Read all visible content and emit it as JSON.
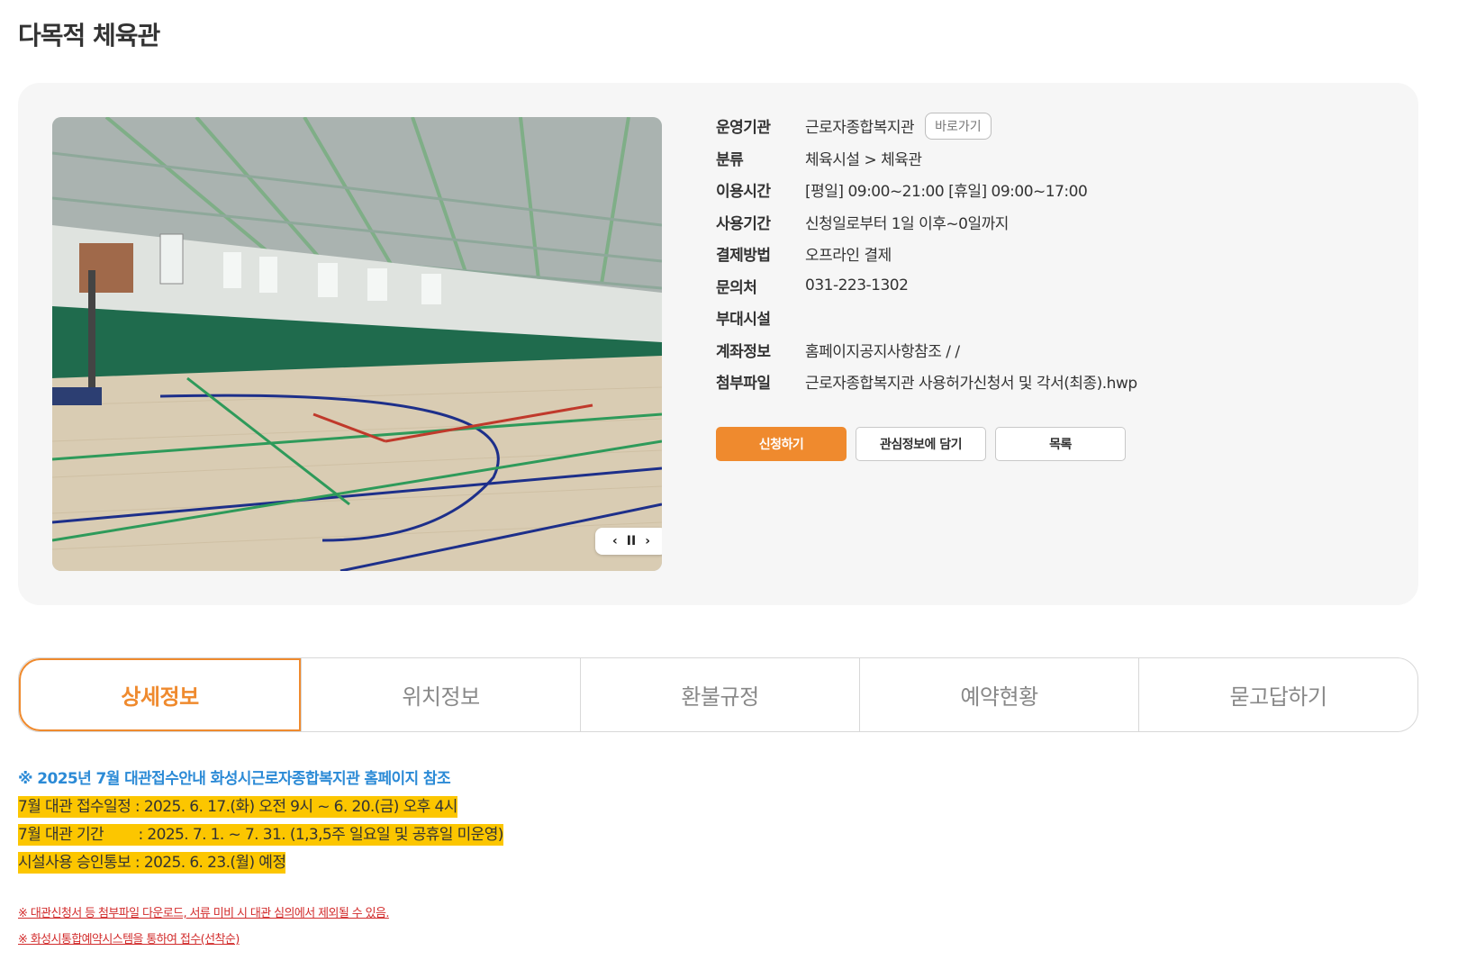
{
  "page": {
    "title": "다목적 체육관"
  },
  "specs": [
    {
      "label": "운영기관",
      "value": "근로자종합복지관"
    },
    {
      "label": "분류",
      "value": "체육시설 > 체육관"
    },
    {
      "label": "이용시간",
      "value": "[평일] 09:00~21:00 [휴일] 09:00~17:00"
    },
    {
      "label": "사용기간",
      "value": "신청일로부터 1일 이후~0일까지"
    },
    {
      "label": "결제방법",
      "value": "오프라인 결제"
    },
    {
      "label": "문의처",
      "value": "031-223-1302"
    },
    {
      "label": "부대시설",
      "value": ""
    },
    {
      "label": "계좌정보",
      "value": "홈페이지공지사항참조 / /"
    },
    {
      "label": "첨부파일",
      "value": "근로자종합복지관 사용허가신청서 및 각서(최종).hwp"
    }
  ],
  "goto_button": "바로가기",
  "slider": {
    "prev": "‹",
    "pause": "II",
    "next": "›"
  },
  "actions": {
    "apply": "신청하기",
    "favorite": "관심정보에 담기",
    "list": "목록"
  },
  "tabs": [
    "상세정보",
    "위치정보",
    "환불규정",
    "예약현황",
    "묻고답하기"
  ],
  "notice": {
    "head": "※ 2025년 7월 대관접수안내 화성시근로자종합복지관 홈페이지 참조",
    "lines": [
      "7월 대관 접수일정 : 2025. 6. 17.(화) 오전 9시 ~ 6. 20.(금) 오후 4시",
      "7월 대관 기간        : 2025. 7. 1. ~ 7. 31. (1,3,5주 일요일 및 공휴일 미운영)",
      "시설사용 승인통보 : 2025. 6. 23.(월) 예정"
    ],
    "small": [
      "※ 대관신청서 등 첨부파일 다운로드, 서류 미비 시 대관 심의에서 제외될 수 있음.",
      "※ 화성시통합예약시스템을 통하여 접수(선착순)"
    ]
  },
  "colors": {
    "accent": "#ef8a2e",
    "notice_blue": "#2b8ad6",
    "highlight": "#fcc600",
    "warning_red": "#d22c2c"
  }
}
